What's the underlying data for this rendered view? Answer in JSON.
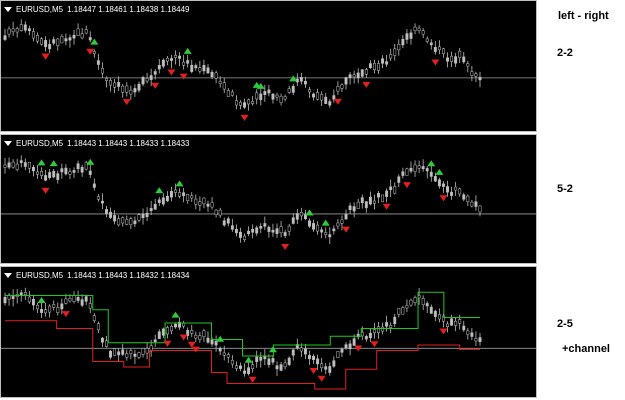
{
  "panels": [
    {
      "header": {
        "symbol": "EURUSD,M5",
        "ohlc": "1.18447 1.18461 1.18438 1.18449"
      },
      "side_label": "left - right",
      "param_label": "2-2",
      "channel": false,
      "collapse_icon": "triangle-down-icon"
    },
    {
      "header": {
        "symbol": "EURUSD,M5",
        "ohlc": "1.18443 1.18443 1.18433 1.18433"
      },
      "side_label": "",
      "param_label": "5-2",
      "channel": false,
      "collapse_icon": "triangle-down-icon"
    },
    {
      "header": {
        "symbol": "EURUSD,M5",
        "ohlc": "1.18443 1.18443 1.18432 1.18434"
      },
      "side_label": "",
      "param_label": "2-5",
      "extra_label": "+channel",
      "channel": true,
      "collapse_icon": "triangle-down-icon"
    }
  ],
  "colors": {
    "background": "#000000",
    "candle": "#bfbfbf",
    "price_line": "#9a9a9a",
    "up_arrow": "#2fcc3a",
    "down_arrow": "#e0201e",
    "channel_upper": "#1ec81e",
    "channel_lower": "#e02020"
  },
  "icons": {
    "up_fractal": "green-up-arrow-icon",
    "down_fractal": "red-down-arrow-icon"
  }
}
